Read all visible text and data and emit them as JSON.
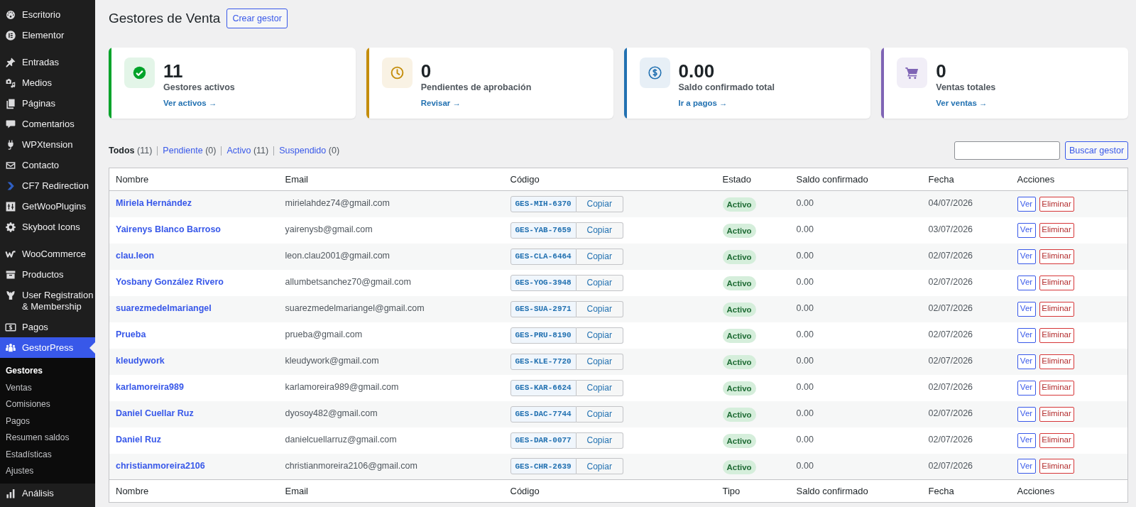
{
  "sidebar": {
    "sections": [
      {
        "items": [
          {
            "label": "Escritorio",
            "selected": false
          },
          {
            "label": "Elementor",
            "selected": false
          }
        ]
      },
      {
        "items": [
          {
            "label": "Entradas",
            "selected": false
          },
          {
            "label": "Medios",
            "selected": false
          },
          {
            "label": "Páginas",
            "selected": false
          },
          {
            "label": "Comentarios",
            "selected": false
          },
          {
            "label": "WPXtension",
            "selected": false
          },
          {
            "label": "Contacto",
            "selected": false
          },
          {
            "label": "CF7 Redirection",
            "selected": false
          },
          {
            "label": "GetWooPlugins",
            "selected": false
          },
          {
            "label": "Skyboot Icons",
            "selected": false
          }
        ]
      },
      {
        "items": [
          {
            "label": "WooCommerce",
            "selected": false
          },
          {
            "label": "Productos",
            "selected": false
          },
          {
            "label": "User Registration & Membership",
            "selected": false
          },
          {
            "label": "Pagos",
            "selected": false
          },
          {
            "label": "GestorPress",
            "selected": true,
            "children": [
              {
                "label": "Gestores",
                "selected": true
              },
              {
                "label": "Ventas",
                "selected": false
              },
              {
                "label": "Comisiones",
                "selected": false
              },
              {
                "label": "Pagos",
                "selected": false
              },
              {
                "label": "Resumen saldos",
                "selected": false
              },
              {
                "label": "Estadísticas",
                "selected": false
              },
              {
                "label": "Ajustes",
                "selected": false
              }
            ]
          },
          {
            "label": "Análisis",
            "selected": false
          }
        ]
      }
    ]
  },
  "page": {
    "title": "Gestores de Venta",
    "action_button": "Crear gestor"
  },
  "stat_cards": [
    {
      "value": "11",
      "label": "Gestores activos",
      "link": "Ver activos →",
      "color": "#00a32a"
    },
    {
      "value": "0",
      "label": "Pendientes de aprobación",
      "link": "Revisar →",
      "color": "#c48d0c"
    },
    {
      "value": "0.00",
      "label": "Saldo confirmado total",
      "link": "Ir a pagos →",
      "color": "#2271b1"
    },
    {
      "value": "0",
      "label": "Ventas totales",
      "link": "Ver ventas →",
      "color": "#7f64b5"
    }
  ],
  "filters": [
    {
      "label": "Todos",
      "count": "(11)",
      "selected": true
    },
    {
      "label": "Pendiente",
      "count": "(0)",
      "selected": false
    },
    {
      "label": "Activo",
      "count": "(11)",
      "selected": false
    },
    {
      "label": "Suspendido",
      "count": "(0)",
      "selected": false
    }
  ],
  "search": {
    "button": "Buscar gestor"
  },
  "table": {
    "columns": [
      "Nombre",
      "Email",
      "Código",
      "Estado",
      "Saldo confirmado",
      "Fecha",
      "Acciones"
    ],
    "footer_columns": [
      "Nombre",
      "Email",
      "Código",
      "Tipo",
      "Saldo confirmado",
      "Fecha",
      "Acciones"
    ],
    "rows": [
      {
        "name": "Miriela Hernández",
        "email": "mirielahdez74@gmail.com",
        "code": "GES-MIH-6370",
        "copy_button": "Copiar",
        "status": "Activo",
        "balance": "0.00",
        "date": "04/07/2026",
        "view_button": "Ver",
        "delete_button": "Eliminar"
      },
      {
        "name": "Yairenys Blanco Barroso",
        "email": "yairenysb@gmail.com",
        "code": "GES-YAB-7659",
        "copy_button": "Copiar",
        "status": "Activo",
        "balance": "0.00",
        "date": "03/07/2026",
        "view_button": "Ver",
        "delete_button": "Eliminar"
      },
      {
        "name": "clau.leon",
        "email": "leon.clau2001@gmail.com",
        "code": "GES-CLA-6464",
        "copy_button": "Copiar",
        "status": "Activo",
        "balance": "0.00",
        "date": "02/07/2026",
        "view_button": "Ver",
        "delete_button": "Eliminar"
      },
      {
        "name": "Yosbany González Rivero",
        "email": "allumbetsanchez70@gmail.com",
        "code": "GES-YOG-3948",
        "copy_button": "Copiar",
        "status": "Activo",
        "balance": "0.00",
        "date": "02/07/2026",
        "view_button": "Ver",
        "delete_button": "Eliminar"
      },
      {
        "name": "suarezmedelmariangel",
        "email": "suarezmedelmariangel@gmail.com",
        "code": "GES-SUA-2971",
        "copy_button": "Copiar",
        "status": "Activo",
        "balance": "0.00",
        "date": "02/07/2026",
        "view_button": "Ver",
        "delete_button": "Eliminar"
      },
      {
        "name": "Prueba",
        "email": "prueba@gmail.com",
        "code": "GES-PRU-8190",
        "copy_button": "Copiar",
        "status": "Activo",
        "balance": "0.00",
        "date": "02/07/2026",
        "view_button": "Ver",
        "delete_button": "Eliminar"
      },
      {
        "name": "kleudywork",
        "email": "kleudywork@gmail.com",
        "code": "GES-KLE-7720",
        "copy_button": "Copiar",
        "status": "Activo",
        "balance": "0.00",
        "date": "02/07/2026",
        "view_button": "Ver",
        "delete_button": "Eliminar"
      },
      {
        "name": "karlamoreira989",
        "email": "karlamoreira989@gmail.com",
        "code": "GES-KAR-6624",
        "copy_button": "Copiar",
        "status": "Activo",
        "balance": "0.00",
        "date": "02/07/2026",
        "view_button": "Ver",
        "delete_button": "Eliminar"
      },
      {
        "name": "Daniel Cuellar Ruz",
        "email": "dyosoy482@gmail.com",
        "code": "GES-DAC-7744",
        "copy_button": "Copiar",
        "status": "Activo",
        "balance": "0.00",
        "date": "02/07/2026",
        "view_button": "Ver",
        "delete_button": "Eliminar"
      },
      {
        "name": "Daniel Ruz",
        "email": "danielcuellarruz@gmail.com",
        "code": "GES-DAR-0077",
        "copy_button": "Copiar",
        "status": "Activo",
        "balance": "0.00",
        "date": "02/07/2026",
        "view_button": "Ver",
        "delete_button": "Eliminar"
      },
      {
        "name": "christianmoreira2106",
        "email": "christianmoreira2106@gmail.com",
        "code": "GES-CHR-2639",
        "copy_button": "Copiar",
        "status": "Activo",
        "balance": "0.00",
        "date": "02/07/2026",
        "view_button": "Ver",
        "delete_button": "Eliminar"
      }
    ]
  }
}
